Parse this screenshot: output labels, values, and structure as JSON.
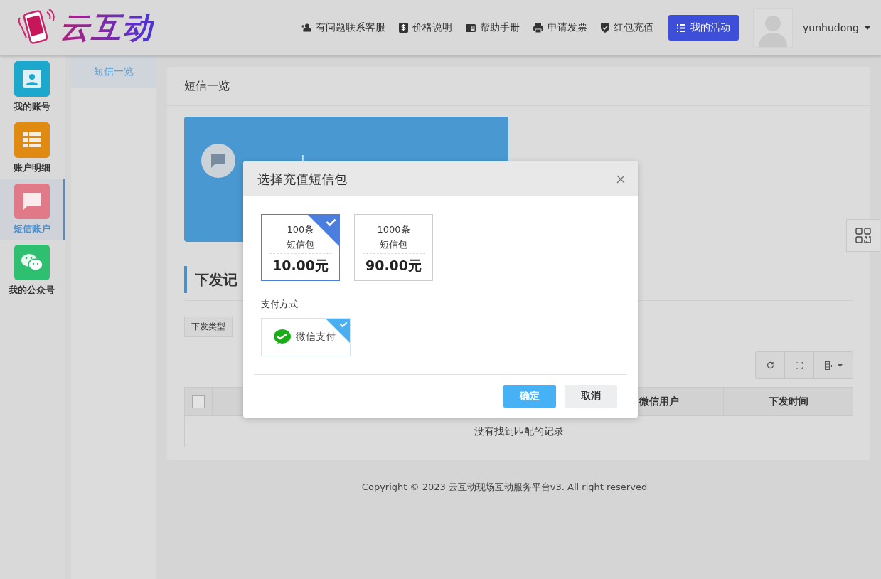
{
  "header": {
    "logo_text": "云互动",
    "nav_links": [
      {
        "kind": "user-plus",
        "label": "有问题联系客服"
      },
      {
        "kind": "dollar",
        "label": "价格说明"
      },
      {
        "kind": "book",
        "label": "帮助手册"
      },
      {
        "kind": "printer",
        "label": "申请发票"
      },
      {
        "kind": "shield",
        "label": "红包充值"
      }
    ],
    "primary_button": {
      "label": "我的活动"
    },
    "username": "yunhudong"
  },
  "sidebar": {
    "items": [
      {
        "kind": "account",
        "label": "我的账号",
        "color": "#1ba8cc",
        "selected": false
      },
      {
        "kind": "table",
        "label": "账户明细",
        "color": "#e08a12",
        "selected": false
      },
      {
        "kind": "chat",
        "label": "短信账户",
        "color": "#e07a88",
        "selected": true
      },
      {
        "kind": "wechat",
        "label": "我的公众号",
        "color": "#2fbf71",
        "selected": false
      }
    ]
  },
  "subnav": {
    "items": [
      {
        "label": "短信一览",
        "selected": true
      }
    ]
  },
  "panel": {
    "title": "短信一览",
    "account_card": {
      "separator": "|"
    },
    "records": {
      "title": "下发记",
      "filter_button": "下发类型",
      "table": {
        "select_all_checked": false,
        "columns": [
          "微信用户",
          "下发时间"
        ],
        "empty_message": "没有找到匹配的记录"
      }
    }
  },
  "footer": {
    "copyright": "Copyright © 2023 云互动现场互动服务平台v3. All right reserved"
  },
  "modal": {
    "title": "选择充值短信包",
    "packages": [
      {
        "count": "100条",
        "name": "短信包",
        "price": "10.00元",
        "selected": true
      },
      {
        "count": "1000条",
        "name": "短信包",
        "price": "90.00元",
        "selected": false
      }
    ],
    "payment_label": "支付方式",
    "payment_methods": [
      {
        "kind": "wechat",
        "label": "微信支付",
        "selected": true
      }
    ],
    "confirm_button": "确定",
    "cancel_button": "取消"
  }
}
